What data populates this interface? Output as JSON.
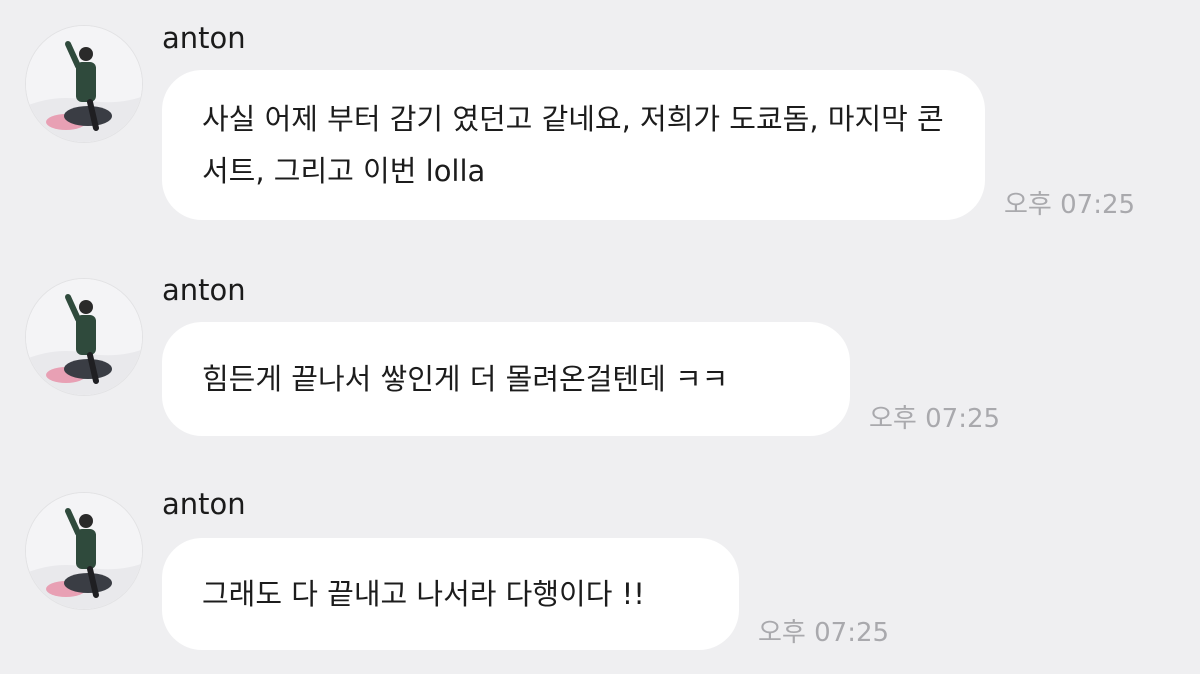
{
  "messages": [
    {
      "sender": "anton",
      "avatar_icon": "profile-avatar-icon",
      "text": "사실 어제 부터 감기 였던고 같네요, 저희가 도쿄돔, 마지막 콘서트, 그리고 이번 lolla",
      "time": "오후 07:25"
    },
    {
      "sender": "anton",
      "avatar_icon": "profile-avatar-icon",
      "text": "힘든게 끝나서 쌓인게 더 몰려온걸텐데 ㅋㅋ",
      "time": "오후 07:25"
    },
    {
      "sender": "anton",
      "avatar_icon": "profile-avatar-icon",
      "text": "그래도 다 끝내고 나서라 다행이다 !!",
      "time": "오후 07:25"
    }
  ],
  "colors": {
    "background": "#efeff1",
    "bubble": "#ffffff",
    "timestamp": "#a9a9ad"
  }
}
